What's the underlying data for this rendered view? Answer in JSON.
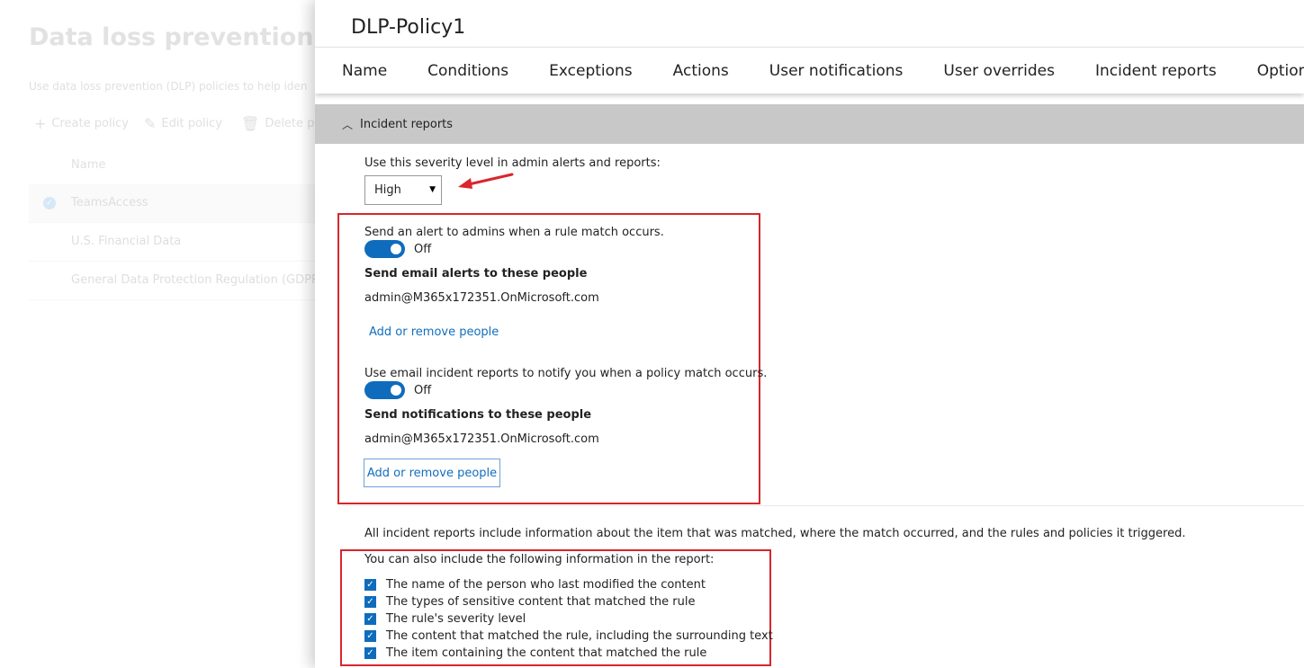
{
  "background": {
    "title": "Data loss prevention",
    "description": "Use data loss prevention (DLP) policies to help iden",
    "commands": {
      "create": "Create policy",
      "edit": "Edit policy",
      "delete": "Delete po"
    },
    "column_name": "Name",
    "rows": [
      "TeamsAccess",
      "U.S. Financial Data",
      "General Data Protection Regulation (GDPR"
    ]
  },
  "panel": {
    "title": "DLP-Policy1",
    "tabs": [
      "Name",
      "Conditions",
      "Exceptions",
      "Actions",
      "User notifications",
      "User overrides",
      "Incident reports",
      "Options"
    ],
    "section_title": "Incident reports",
    "severity_label": "Use this severity level in admin alerts and reports:",
    "severity_value": "High",
    "alert": {
      "label": "Send an alert to admins when a rule match occurs.",
      "toggle_text": "Off",
      "recipients_heading": "Send email alerts to these people",
      "recipient": "admin@M365x172351.OnMicrosoft.com",
      "link": "Add or remove people"
    },
    "incident": {
      "label": "Use email incident reports to notify you when a policy match occurs.",
      "toggle_text": "Off",
      "recipients_heading": "Send notifications to these people",
      "recipient": "admin@M365x172351.OnMicrosoft.com",
      "link": "Add or remove people"
    },
    "info_text": "All incident reports include information about the item that was matched, where the match occurred, and the rules and policies it triggered.",
    "include_label": "You can also include the following information in the report:",
    "options": [
      "The name of the person who last modified the content",
      "The types of sensitive content that matched the rule",
      "The rule's severity level",
      "The content that matched the rule, including the surrounding text",
      "The item containing the content that matched the rule"
    ]
  },
  "colors": {
    "accent": "#0f6cbd",
    "highlight_box": "#d9262c",
    "section_header": "#c8c8c8"
  }
}
